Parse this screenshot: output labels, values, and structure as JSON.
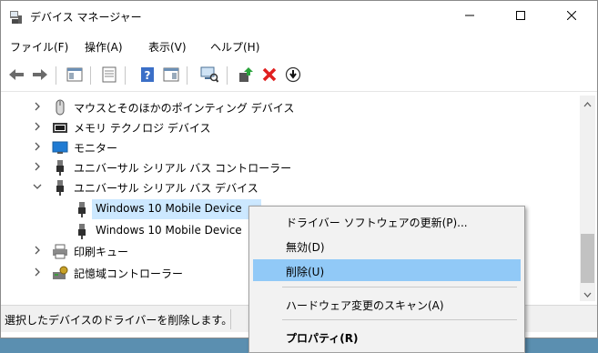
{
  "window": {
    "title": "デバイス マネージャー",
    "icons": {
      "app": "device-manager-icon",
      "minimize": "minimize-icon",
      "maximize": "maximize-icon",
      "close": "close-icon"
    }
  },
  "menu": [
    "ファイル(F)",
    "操作(A)",
    "表示(V)",
    "ヘルプ(H)"
  ],
  "toolbar": [
    "back-icon",
    "forward-icon",
    "properties-icon",
    "update-icon",
    "help-icon",
    "view-icon",
    "scan-icon",
    "update-driver-icon",
    "uninstall-icon",
    "disable-icon"
  ],
  "tree": {
    "rows": [
      {
        "label": "マウスとそのほかのポインティング デバイス",
        "expanded": false,
        "icon": "mouse-icon"
      },
      {
        "label": "メモリ テクノロジ デバイス",
        "expanded": false,
        "icon": "memory-icon"
      },
      {
        "label": "モニター",
        "expanded": false,
        "icon": "monitor-icon"
      },
      {
        "label": "ユニバーサル シリアル バス コントローラー",
        "expanded": false,
        "icon": "usb-icon"
      },
      {
        "label": "ユニバーサル シリアル バス デバイス",
        "expanded": true,
        "icon": "usb-icon"
      },
      {
        "label": "Windows 10 Mobile Device",
        "child": true,
        "selected": true,
        "icon": "usb-device-icon"
      },
      {
        "label": "Windows 10 Mobile Device",
        "child": true,
        "icon": "usb-device-icon"
      },
      {
        "label": "印刷キュー",
        "expanded": false,
        "icon": "printer-icon"
      },
      {
        "label": "記憶域コントローラー",
        "expanded": false,
        "icon": "storage-icon"
      }
    ]
  },
  "status": {
    "text": "選択したデバイスのドライバーを削除します。"
  },
  "context_menu": {
    "items": [
      {
        "label": "ドライバー ソフトウェアの更新(P)..."
      },
      {
        "label": "無効(D)"
      },
      {
        "label": "削除(U)",
        "highlighted": true
      },
      {
        "label": "ハードウェア変更のスキャン(A)"
      },
      {
        "label": "プロパティ(R)",
        "bold": true
      }
    ]
  },
  "colors": {
    "selection": "#cce8ff",
    "menu_highlight": "#91c9f7",
    "desktop": "#5b8fb0"
  }
}
